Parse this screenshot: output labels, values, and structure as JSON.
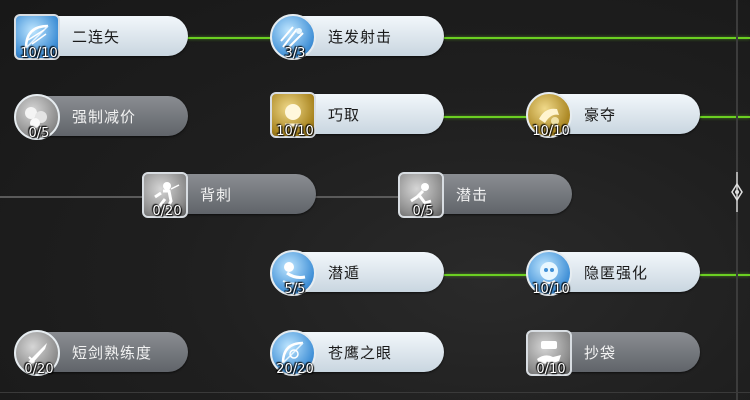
{
  "skills": {
    "erlianshi": {
      "name": "二连矢",
      "level": "10/10",
      "icon": "bow-icon"
    },
    "lianfasheji": {
      "name": "连发射击",
      "level": "3/3",
      "icon": "arrow-burst-icon"
    },
    "qiangzhijianjia": {
      "name": "强制减价",
      "level": "0/5",
      "icon": "coins-icon"
    },
    "qiaoqu": {
      "name": "巧取",
      "level": "10/10",
      "icon": "grab-icon"
    },
    "haoduo": {
      "name": "豪夺",
      "level": "10/10",
      "icon": "snatch-icon"
    },
    "beici": {
      "name": "背刺",
      "level": "0/20",
      "icon": "backstab-icon"
    },
    "qianji": {
      "name": "潜击",
      "level": "0/5",
      "icon": "sneak-attack-icon"
    },
    "qiandun": {
      "name": "潜遁",
      "level": "5/5",
      "icon": "stealth-icon"
    },
    "yinniqianghua": {
      "name": "隐匿强化",
      "level": "10/10",
      "icon": "hide-enhance-icon"
    },
    "duanjianshuliandu": {
      "name": "短剑熟练度",
      "level": "0/20",
      "icon": "dagger-icon"
    },
    "canyingzhiyan": {
      "name": "苍鹰之眼",
      "level": "20/20",
      "icon": "eagle-eye-icon"
    },
    "chaodai": {
      "name": "抄袋",
      "level": "0/10",
      "icon": "pickpocket-icon"
    }
  },
  "scrollbar": {
    "icon": "ornament-scroll-icon"
  },
  "colors": {
    "active_link": "#6bcf22",
    "inactive_link": "#5a5a5a",
    "unlocked_pill": "#e6eef4",
    "locked_pill": "#72767c"
  }
}
